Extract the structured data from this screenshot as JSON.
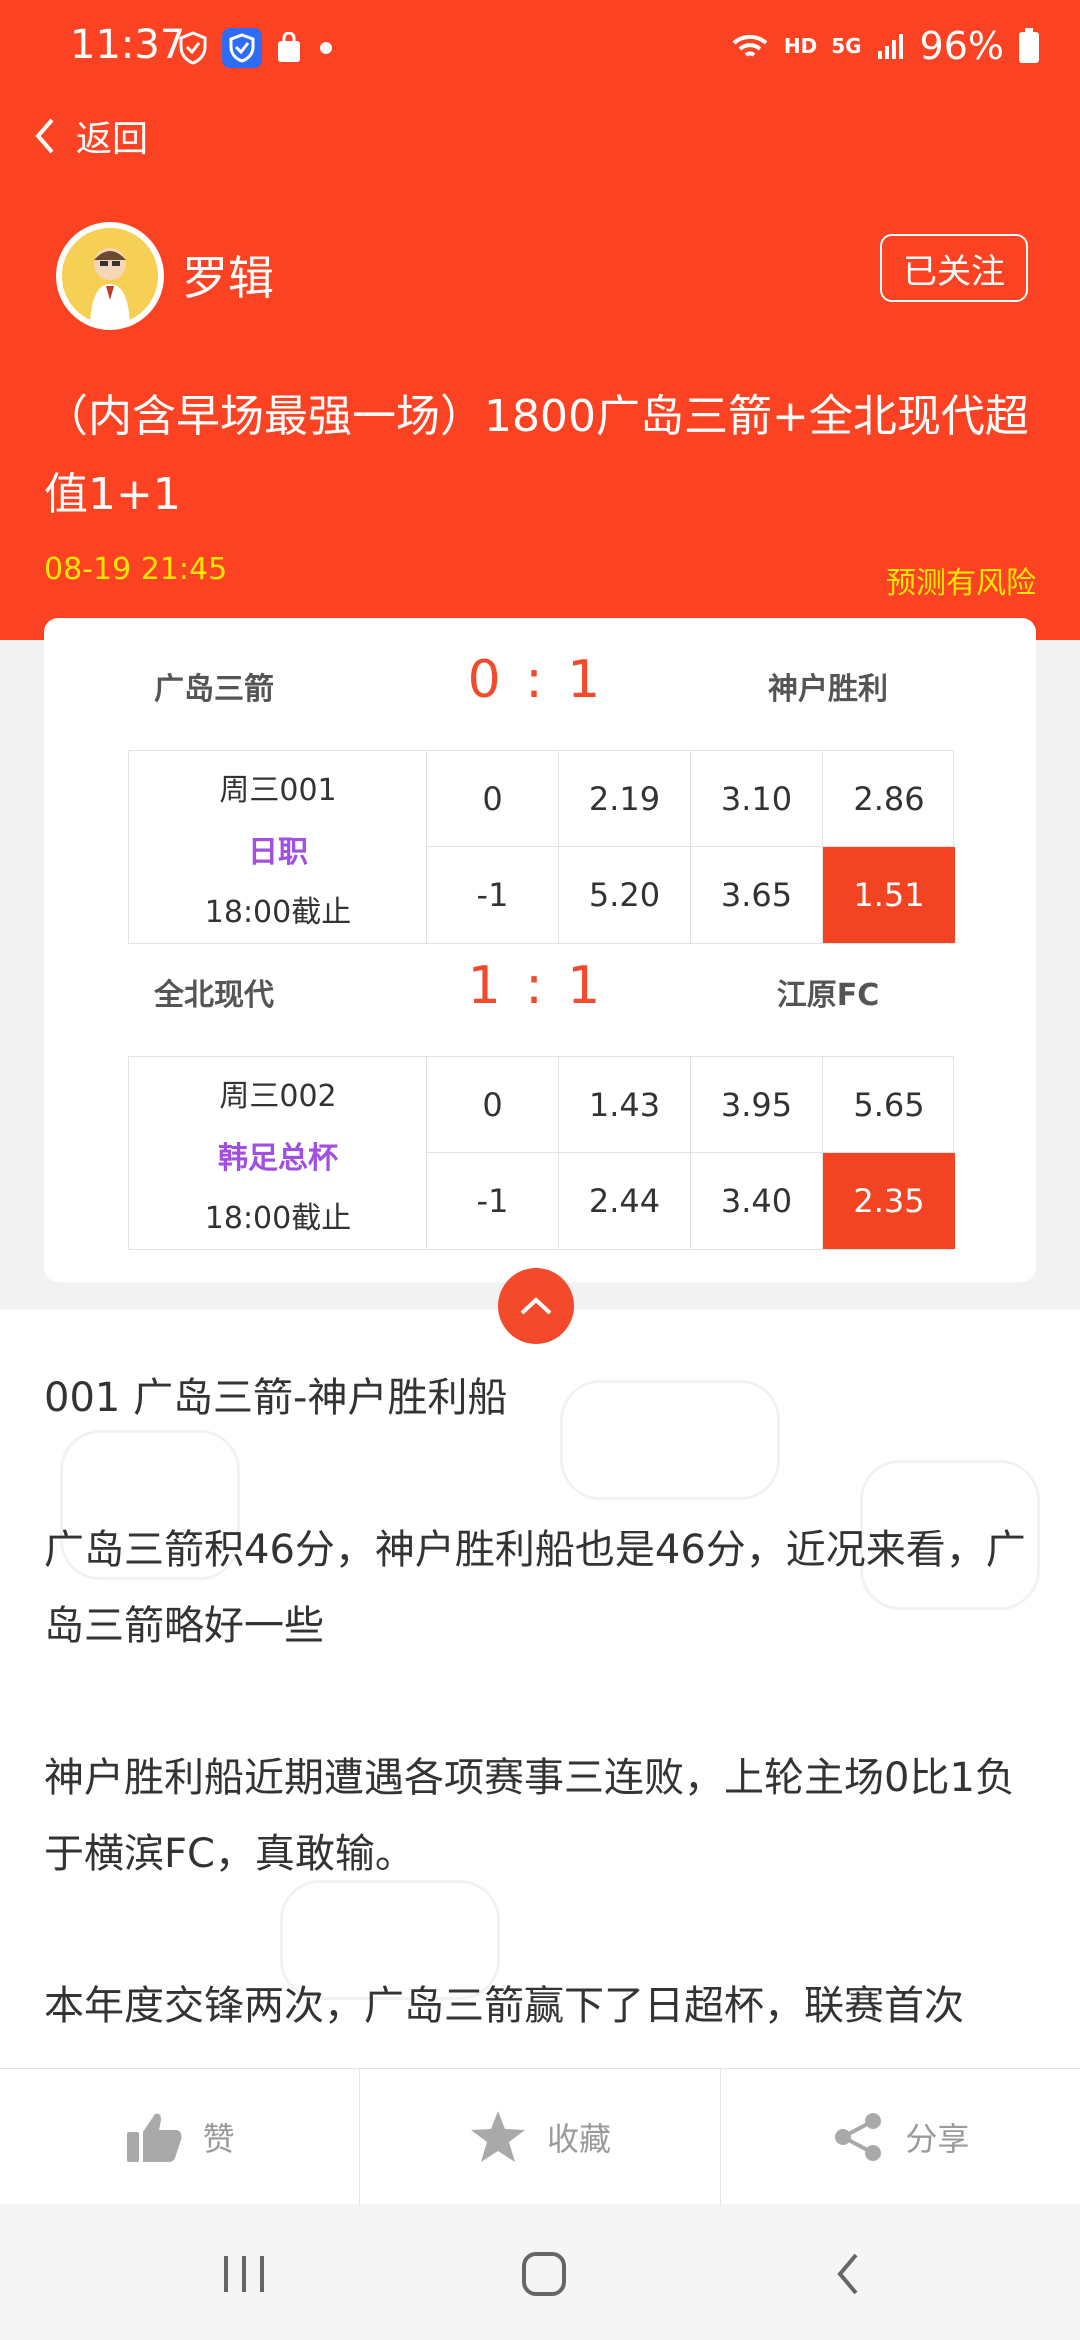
{
  "status_bar": {
    "time": "11:37",
    "network": "HD",
    "signal": "5G",
    "battery": "96%"
  },
  "nav": {
    "back_label": "返回"
  },
  "author": {
    "name": "罗辑",
    "follow_label": "已关注"
  },
  "post": {
    "title": "（内含早场最强一场）1800广岛三箭+全北现代超值1+1",
    "date": "08-19 21:45",
    "risk_note": "预测有风险"
  },
  "matches": [
    {
      "home": "广岛三箭",
      "score": "0 : 1",
      "away": "神户胜利",
      "week": "周三001",
      "league": "日职",
      "deadline": "18:00截止",
      "rows": [
        {
          "handicap": "0",
          "odds": [
            "2.19",
            "3.10",
            "2.86"
          ]
        },
        {
          "handicap": "-1",
          "odds": [
            "5.20",
            "3.65",
            "1.51"
          ]
        }
      ]
    },
    {
      "home": "全北现代",
      "score": "1 : 1",
      "away": "江原FC",
      "week": "周三002",
      "league": "韩足总杯",
      "deadline": "18:00截止",
      "rows": [
        {
          "handicap": "0",
          "odds": [
            "1.43",
            "3.95",
            "5.65"
          ]
        },
        {
          "handicap": "-1",
          "odds": [
            "2.44",
            "3.40",
            "2.35"
          ]
        }
      ]
    }
  ],
  "article": {
    "paragraphs": [
      "001 广岛三箭-神户胜利船",
      "广岛三箭积46分，神户胜利船也是46分，近况来看，广岛三箭略好一些",
      "神户胜利船近期遭遇各项赛事三连败，上轮主场0比1负于横滨FC，真敢输。",
      "本年度交锋两次，广岛三箭赢下了日超杯，联赛首次"
    ]
  },
  "actions": {
    "like": "赞",
    "favorite": "收藏",
    "share": "分享"
  },
  "colors": {
    "brand": "#fb4222",
    "highlight": "#f24422",
    "league": "#a24ee0",
    "date_text": "#ffe600"
  }
}
